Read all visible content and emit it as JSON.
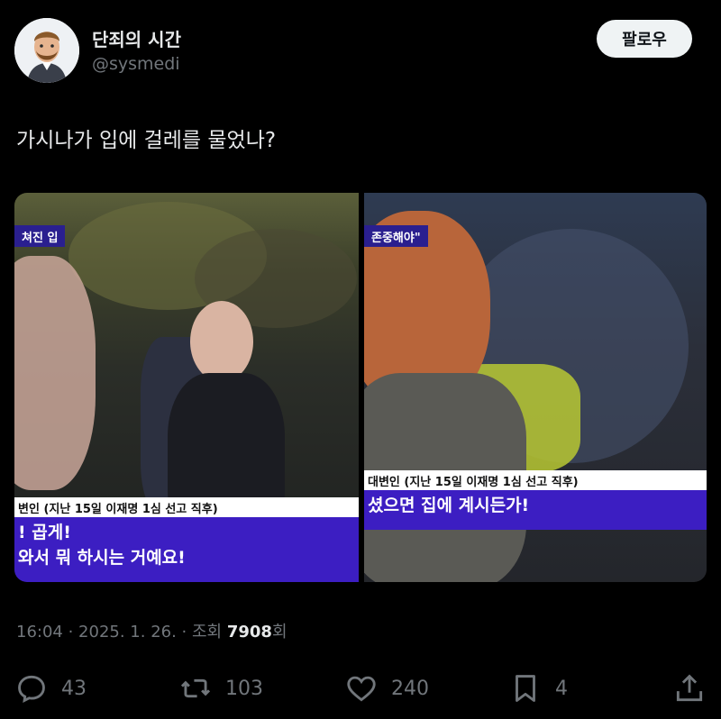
{
  "user": {
    "display_name": "단죄의 시간",
    "handle": "@sysmedi",
    "follow_label": "팔로우"
  },
  "tweet": {
    "text": "가시나가 입에 걸레를 물었나?"
  },
  "media": {
    "left": {
      "tag": "쳐진 입",
      "caption_small": "변인 (지난 15일 이재명 1심 선고 직후)",
      "caption_line1": "! 곱게!",
      "caption_line2": "와서 뭐 하시는 거예요!"
    },
    "right": {
      "tag": "존중해야\"",
      "caption_small": "대변인 (지난 15일 이재명 1심 선고 직후)",
      "caption_line1": "셨으면 집에 계시든가!"
    }
  },
  "meta": {
    "time": "16:04",
    "date": "2025. 1. 26.",
    "views_label": "조회",
    "views_count": "7908",
    "views_suffix": "회"
  },
  "actions": {
    "replies": "43",
    "reposts": "103",
    "likes": "240",
    "bookmarks": "4"
  },
  "colors": {
    "background": "#000000",
    "text": "#e7e9ea",
    "secondary": "#71767b",
    "follow_bg": "#eff3f4",
    "caption_purple": "#3c1ec2"
  }
}
